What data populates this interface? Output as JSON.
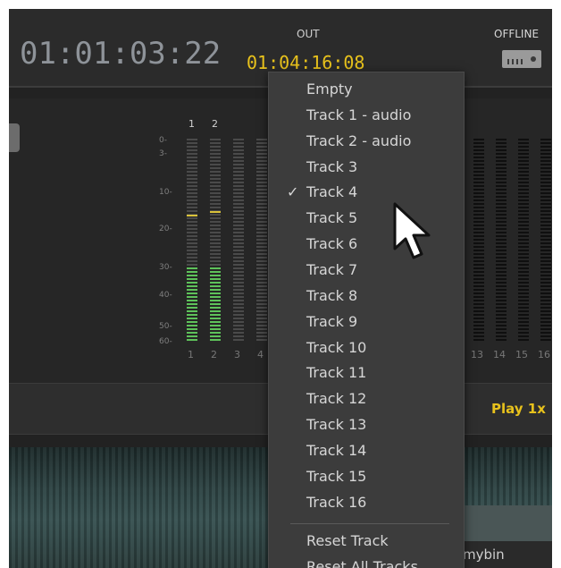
{
  "header": {
    "timecode": "01:01:03:22",
    "out_label": "OUT",
    "out_timecode": "01:04:16:08",
    "status_label": "OFFLINE",
    "status_icon": "tape-deck-icon"
  },
  "meters": {
    "scale": [
      "0-",
      "3-",
      "10-",
      "20-",
      "30-",
      "40-",
      "50-",
      "60-"
    ],
    "top_numbers": [
      "1",
      "2"
    ],
    "bottom_numbers_left": [
      "1",
      "2",
      "3",
      "4"
    ],
    "bottom_numbers_right": [
      "13",
      "14",
      "15",
      "16"
    ],
    "active_color": "#5ec25a",
    "peak_color": "#d9c23a"
  },
  "playbar": {
    "speed_label": "Play 1x"
  },
  "bin": {
    "label": "mybin"
  },
  "menu": {
    "items": [
      {
        "label": "Empty",
        "checked": false
      },
      {
        "label": "Track 1 - audio",
        "checked": false
      },
      {
        "label": "Track 2 - audio",
        "checked": false
      },
      {
        "label": "Track 3",
        "checked": false
      },
      {
        "label": "Track 4",
        "checked": true
      },
      {
        "label": "Track 5",
        "checked": false
      },
      {
        "label": "Track 6",
        "checked": false
      },
      {
        "label": "Track 7",
        "checked": false
      },
      {
        "label": "Track 8",
        "checked": false
      },
      {
        "label": "Track 9",
        "checked": false
      },
      {
        "label": "Track 10",
        "checked": false
      },
      {
        "label": "Track 11",
        "checked": false
      },
      {
        "label": "Track 12",
        "checked": false
      },
      {
        "label": "Track 13",
        "checked": false
      },
      {
        "label": "Track 14",
        "checked": false
      },
      {
        "label": "Track 15",
        "checked": false
      },
      {
        "label": "Track 16",
        "checked": false
      }
    ],
    "check_glyph": "✓",
    "reset_track": "Reset Track",
    "reset_all": "Reset All Tracks"
  }
}
